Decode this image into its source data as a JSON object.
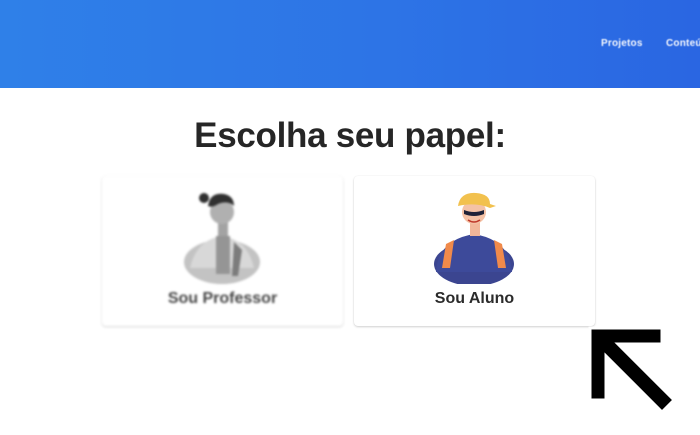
{
  "header": {
    "nav": [
      {
        "label": "Projetos"
      },
      {
        "label": "Conteúdos"
      }
    ]
  },
  "main": {
    "title": "Escolha seu papel:",
    "roles": [
      {
        "label": "Sou Professor",
        "icon": "teacher-illustration",
        "state": "blurred"
      },
      {
        "label": "Sou Aluno",
        "icon": "student-illustration",
        "state": "focused"
      }
    ]
  },
  "colors": {
    "header_bg": "#2d74e6",
    "title_text": "#262626",
    "card_bg": "#ffffff",
    "cursor": "#000000"
  },
  "overlay": {
    "icon": "arrow-pointer-icon"
  }
}
